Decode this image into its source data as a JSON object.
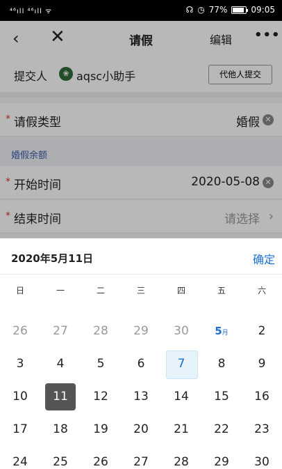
{
  "status_bar": {
    "left": "⁴⁶ıll ⁴⁶ıll ᯤ",
    "battery_text": "77%",
    "time": "09:05"
  },
  "nav": {
    "back_icon": "‹",
    "close_icon": "✕",
    "title": "请假",
    "edit": "编辑",
    "more": "•••"
  },
  "submitter": {
    "label": "提交人",
    "name": "aqsc小助手",
    "proxy_button": "代他人提交"
  },
  "fields": {
    "leave_type": {
      "label": "请假类型",
      "value": "婚假"
    },
    "balance_hint": "婚假余额",
    "start_time": {
      "label": "开始时间",
      "value": "2020-05-08"
    },
    "end_time": {
      "label": "结束时间",
      "placeholder": "请选择"
    }
  },
  "picker": {
    "selected_date": "2020年5月11日",
    "confirm": "确定",
    "weekdays": [
      "日",
      "一",
      "二",
      "三",
      "四",
      "五",
      "六"
    ],
    "days": [
      {
        "d": "26",
        "type": "other"
      },
      {
        "d": "27",
        "type": "other"
      },
      {
        "d": "28",
        "type": "other"
      },
      {
        "d": "29",
        "type": "other"
      },
      {
        "d": "30",
        "type": "other"
      },
      {
        "d": "5",
        "suffix": "月",
        "type": "month-start"
      },
      {
        "d": "2",
        "type": ""
      },
      {
        "d": "3",
        "type": ""
      },
      {
        "d": "4",
        "type": ""
      },
      {
        "d": "5",
        "type": ""
      },
      {
        "d": "6",
        "type": ""
      },
      {
        "d": "7",
        "type": "today"
      },
      {
        "d": "8",
        "type": ""
      },
      {
        "d": "9",
        "type": ""
      },
      {
        "d": "10",
        "type": ""
      },
      {
        "d": "11",
        "type": "selected"
      },
      {
        "d": "12",
        "type": ""
      },
      {
        "d": "13",
        "type": ""
      },
      {
        "d": "14",
        "type": ""
      },
      {
        "d": "15",
        "type": ""
      },
      {
        "d": "16",
        "type": ""
      },
      {
        "d": "17",
        "type": ""
      },
      {
        "d": "18",
        "type": ""
      },
      {
        "d": "19",
        "type": ""
      },
      {
        "d": "20",
        "type": ""
      },
      {
        "d": "21",
        "type": ""
      },
      {
        "d": "22",
        "type": ""
      },
      {
        "d": "23",
        "type": ""
      },
      {
        "d": "24",
        "type": ""
      },
      {
        "d": "25",
        "type": ""
      },
      {
        "d": "26",
        "type": ""
      },
      {
        "d": "27",
        "type": ""
      },
      {
        "d": "28",
        "type": ""
      },
      {
        "d": "29",
        "type": ""
      },
      {
        "d": "30",
        "type": ""
      }
    ]
  },
  "colors": {
    "accent": "#1c6fd0",
    "required": "#d9342b",
    "selected_bg": "#555555",
    "today_bg": "#e6f3fb"
  }
}
